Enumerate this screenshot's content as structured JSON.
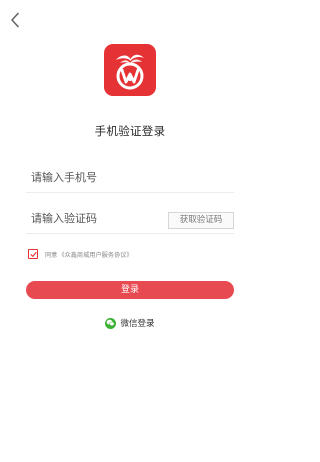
{
  "header": {
    "back_icon": "chevron-left-icon"
  },
  "logo": {
    "icon": "app-logo-icon",
    "color": "#e53235"
  },
  "title": "手机验证登录",
  "phone_field": {
    "value": "",
    "placeholder": "请输入手机号"
  },
  "code_field": {
    "value": "",
    "placeholder": "请输入验证码",
    "get_code_label": "获取验证码"
  },
  "agreement": {
    "checked": true,
    "prefix": "同意",
    "link": "《众鑫商城用户服务协议》"
  },
  "login_button": {
    "label": "登录",
    "color": "#e84a51"
  },
  "wechat_login": {
    "icon": "wechat-icon",
    "label": "微信登录",
    "color": "#3cb034"
  }
}
